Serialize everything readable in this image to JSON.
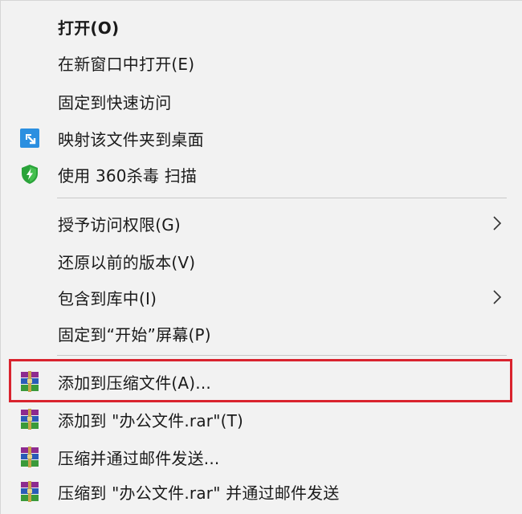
{
  "menu": {
    "items": [
      {
        "label": "打开(O)",
        "icon": null,
        "submenu": false
      },
      {
        "label": "在新窗口中打开(E)",
        "icon": null,
        "submenu": false
      },
      {
        "label": "固定到快速访问",
        "icon": null,
        "submenu": false
      },
      {
        "label": "映射该文件夹到桌面",
        "icon": "map-folder-icon",
        "submenu": false
      },
      {
        "label": "使用 360杀毒 扫描",
        "icon": "360-shield-icon",
        "submenu": false
      },
      {
        "label": "授予访问权限(G)",
        "icon": null,
        "submenu": true
      },
      {
        "label": "还原以前的版本(V)",
        "icon": null,
        "submenu": false
      },
      {
        "label": "包含到库中(I)",
        "icon": null,
        "submenu": true
      },
      {
        "label": "固定到“开始”屏幕(P)",
        "icon": null,
        "submenu": false
      },
      {
        "label": "添加到压缩文件(A)...",
        "icon": "winrar-icon",
        "submenu": false,
        "highlighted": true
      },
      {
        "label": "添加到 \"办公文件.rar\"(T)",
        "icon": "winrar-icon",
        "submenu": false
      },
      {
        "label": "压缩并通过邮件发送...",
        "icon": "winrar-icon",
        "submenu": false
      },
      {
        "label": "压缩到 \"办公文件.rar\" 并通过邮件发送",
        "icon": "winrar-icon",
        "submenu": false
      }
    ]
  },
  "colors": {
    "highlight_border": "#d9232e",
    "menu_background": "#f2f2f2",
    "text": "#1a1a1a"
  }
}
